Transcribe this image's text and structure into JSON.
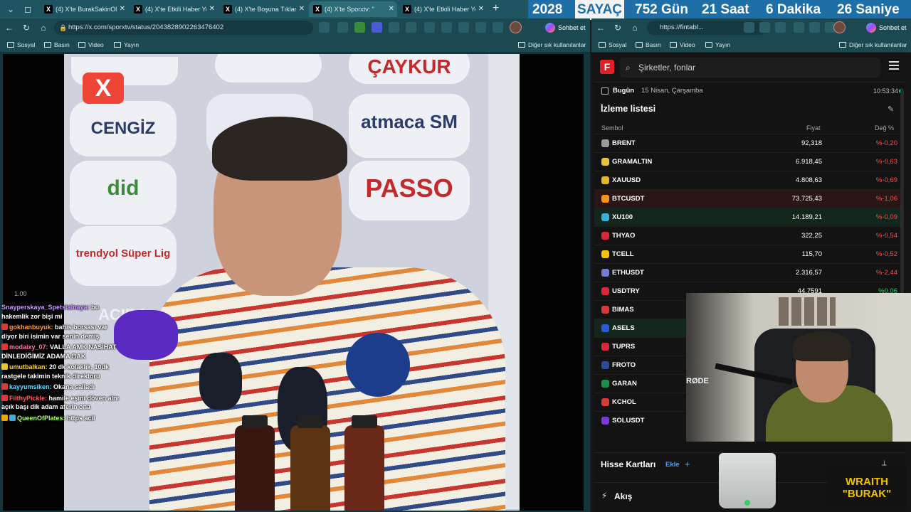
{
  "tabs": [
    {
      "label": "(4) X'te BurakSakinOl: \"G",
      "active": false
    },
    {
      "label": "(4) X'te Etkili Haber Yeni",
      "active": false
    },
    {
      "label": "(4) X'te Boşuna Tıklama:",
      "active": false
    },
    {
      "label": "(4) X'te Sporxtv: \"",
      "active": true
    },
    {
      "label": "(4) X'te Etkili Haber Yeni",
      "active": false
    }
  ],
  "counter": {
    "year": "2028",
    "title": "SAYAÇ",
    "days": "752 Gün",
    "hours": "21 Saat",
    "minutes": "6 Dakika",
    "seconds": "26 Saniye"
  },
  "left_browser": {
    "url": "https://x.com/sporxtv/status/2043828902263476402",
    "chat_button": "Sohbet et",
    "favorites": [
      "Sosyal",
      "Basın",
      "Video",
      "Yayın"
    ],
    "other_favorites": "Diğer sık kullanılanlar",
    "video": {
      "speed_label": "1.00",
      "badge": "X",
      "sponsors": [
        "ÇAYKUR",
        "CENGİZ",
        "atmaca SM",
        "did",
        "PASSO",
        "trendyol Süper Lig",
        "ACIBA"
      ]
    },
    "chat": [
      {
        "user": "Snayperskaya_Spetsialnaya:",
        "text": " bu hakemlik zor bişi mi",
        "color": "#c69bff"
      },
      {
        "user": "gokhanbuyuk:",
        "text": " bahis borsası var diyor biri isimin var senin demiş",
        "color": "#ff9a3c"
      },
      {
        "user": "modaixy_07:",
        "text": " VALLA AMK NASİHAT DİNLEDİĞİMİZ ADAMA BAK",
        "color": "#ff79b0"
      },
      {
        "user": "umutbalkan:",
        "text": " 20 dk kolaklık, 10dk rastgele takimin teknik direktoru",
        "color": "#ffd24a"
      },
      {
        "user": "kayyumsiken:",
        "text": " Okana salladı",
        "color": "#5de0ff"
      },
      {
        "user": "FilthyPickle:",
        "text": " hamile eşini döven alnı açık başı dik adam aferin ona",
        "color": "#ff5e5e"
      },
      {
        "user": "QueenOfPlates:",
        "text": " https acil",
        "color": "#a6ff6b"
      }
    ]
  },
  "right_browser": {
    "url": "https://fintabl...",
    "chat_button": "Sohbet et",
    "favorites": [
      "Sosyal",
      "Basın",
      "Video",
      "Yayın"
    ],
    "other_favorites": "Diğer sık kullanılanlar",
    "search_placeholder": "Şirketler, fonlar",
    "today_label": "Bugün",
    "date": "15 Nisan, Çarşamba",
    "time": "10:53:34",
    "watchlist_title": "İzleme listesi",
    "columns": {
      "symbol": "Sembol",
      "price": "Fiyat",
      "change": "Değ %"
    },
    "rows": [
      {
        "symbol": "BRENT",
        "price": "92,318",
        "change": "%-0,20",
        "icon": "#9a9a9a"
      },
      {
        "symbol": "GRAMALTIN",
        "price": "6.918,45",
        "change": "%-0,63",
        "icon": "#e8c33a"
      },
      {
        "symbol": "XAUUSD",
        "price": "4.808,63",
        "change": "%-0,69",
        "icon": "#e8b52a"
      },
      {
        "symbol": "BTCUSDT",
        "price": "73.725,43",
        "change": "%-1,06",
        "icon": "#f7931a"
      },
      {
        "symbol": "XU100",
        "price": "14.189,21",
        "change": "%-0,09",
        "icon": "#3ab0d8"
      },
      {
        "symbol": "THYAO",
        "price": "322,25",
        "change": "%-0,54",
        "icon": "#d8283a"
      },
      {
        "symbol": "TCELL",
        "price": "115,70",
        "change": "%-0,52",
        "icon": "#f2c600"
      },
      {
        "symbol": "ETHUSDT",
        "price": "2.316,57",
        "change": "%-2,44",
        "icon": "#6f7cd8"
      },
      {
        "symbol": "USDTRY",
        "price": "44,7591",
        "change": "%0,06",
        "icon": "#d8283a"
      },
      {
        "symbol": "BIMAS",
        "price": "",
        "change": "",
        "icon": "#d83a3a"
      },
      {
        "symbol": "ASELS",
        "price": "",
        "change": "",
        "icon": "#2a5bd8"
      },
      {
        "symbol": "TUPRS",
        "price": "",
        "change": "",
        "icon": "#d8283a"
      },
      {
        "symbol": "FROTO",
        "price": "",
        "change": "",
        "icon": "#2b4b9a"
      },
      {
        "symbol": "GARAN",
        "price": "",
        "change": "",
        "icon": "#1b8f4a"
      },
      {
        "symbol": "KCHOL",
        "price": "",
        "change": "",
        "icon": "#d83a3a"
      },
      {
        "symbol": "SOLUSDT",
        "price": "",
        "change": "",
        "icon": "#7a3ad8"
      }
    ],
    "cards_title": "Hisse Kartları",
    "cards_add": "Ekle",
    "feed_title": "Akış"
  },
  "overlay": {
    "webcam_brand": "RØDE",
    "wraith_line1": "WRAITH",
    "wraith_line2": "\"BURAK\""
  }
}
